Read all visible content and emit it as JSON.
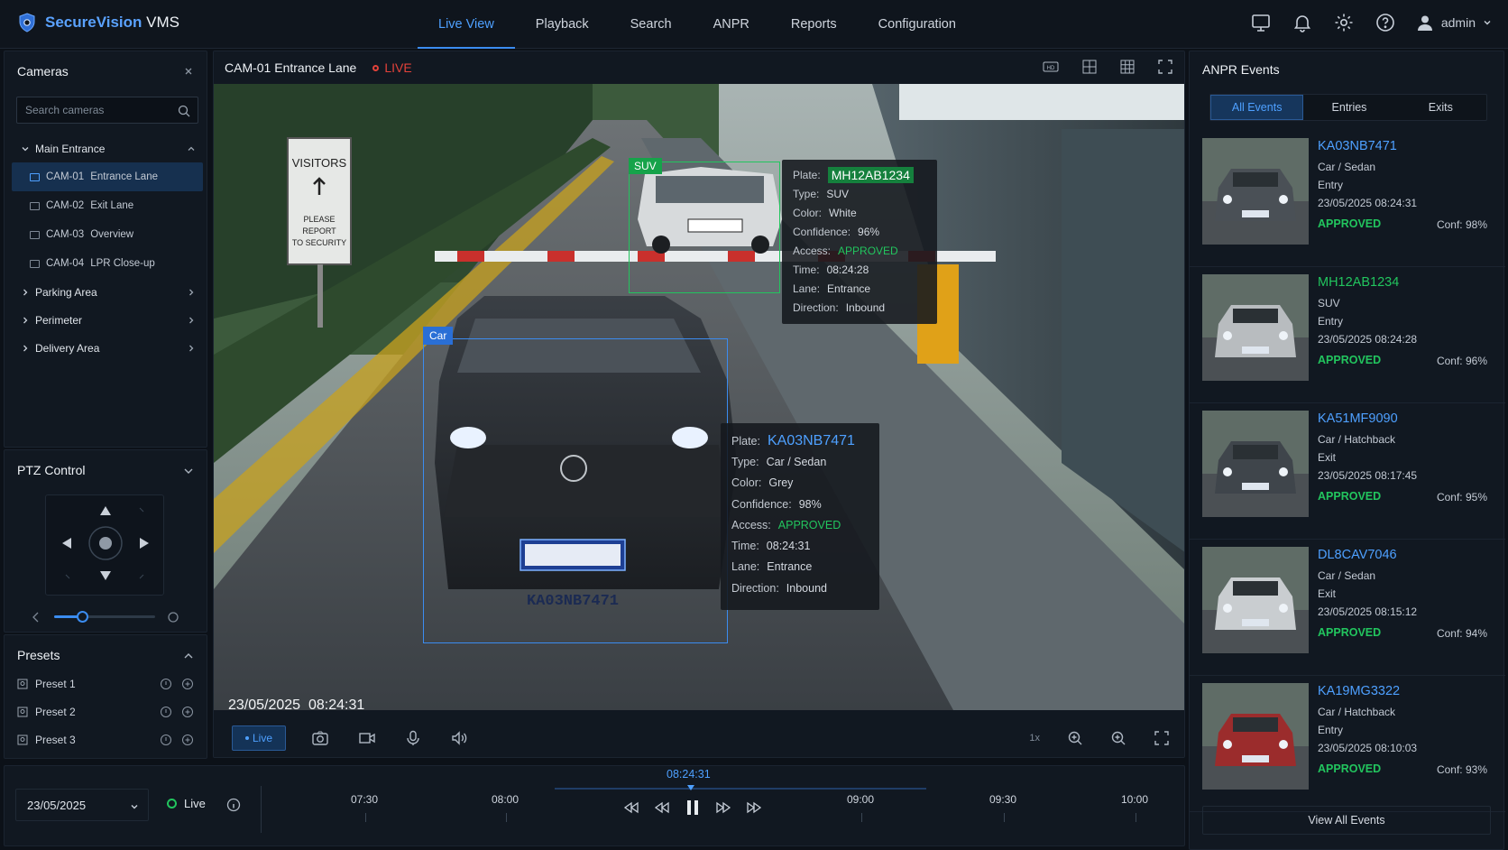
{
  "app": {
    "name_brand": "SecureVision",
    "name_suffix": "VMS"
  },
  "nav": {
    "tabs": [
      "Live View",
      "Playback",
      "Search",
      "ANPR",
      "Reports",
      "Configuration"
    ],
    "active": 0
  },
  "user": {
    "name": "admin"
  },
  "cameras_panel": {
    "title": "Cameras",
    "search_placeholder": "Search cameras",
    "groups": [
      {
        "name": "Main Entrance",
        "expanded": true,
        "cameras": [
          {
            "id": "CAM-01",
            "name": "Entrance Lane",
            "selected": true
          },
          {
            "id": "CAM-02",
            "name": "Exit Lane"
          },
          {
            "id": "CAM-03",
            "name": "Overview"
          },
          {
            "id": "CAM-04",
            "name": "LPR Close-up"
          }
        ]
      },
      {
        "name": "Parking Area"
      },
      {
        "name": "Perimeter"
      },
      {
        "name": "Delivery Area"
      }
    ]
  },
  "ptz": {
    "title": "PTZ Control",
    "zoom_level": 0.28
  },
  "presets": {
    "title": "Presets",
    "items": [
      "Preset 1",
      "Preset 2",
      "Preset 3"
    ]
  },
  "video": {
    "camera_title": "CAM-01 Entrance Lane",
    "live_label": "LIVE",
    "timestamp": "23/05/2025  08:24:31",
    "sign": {
      "line1": "VISITORS",
      "line2": "PLEASE",
      "line3": "REPORT",
      "line4": "TO SECURITY"
    },
    "detections": [
      {
        "tag": "SUV",
        "plate": "MH12AB1234",
        "type": "SUV",
        "color": "White",
        "confidence": "96%",
        "access": "APPROVED",
        "time": "08:24:28",
        "lane": "Entrance",
        "direction": "Inbound"
      },
      {
        "tag": "Car",
        "plate": "KA03NB7471",
        "type": "Car / Sedan",
        "color": "Grey",
        "confidence": "98%",
        "access": "APPROVED",
        "time": "08:24:31",
        "lane": "Entrance",
        "direction": "Inbound"
      }
    ],
    "info_labels": {
      "plate": "Plate:",
      "type": "Type:",
      "color": "Color:",
      "confidence": "Confidence:",
      "access": "Access:",
      "time": "Time:",
      "lane": "Lane:",
      "direction": "Direction:"
    },
    "controls": {
      "live_btn": "Live",
      "speed": "1x"
    }
  },
  "anpr": {
    "title": "ANPR Events",
    "filters": [
      "All Events",
      "Entries",
      "Exits"
    ],
    "active_filter": 0,
    "events": [
      {
        "plate": "KA03NB7471",
        "type": "Car / Sedan",
        "dir": "Entry",
        "datetime": "23/05/2025 08:24:31",
        "status": "APPROVED",
        "conf": "Conf: 98%",
        "color": "blue"
      },
      {
        "plate": "MH12AB1234",
        "type": "SUV",
        "dir": "Entry",
        "datetime": "23/05/2025 08:24:28",
        "status": "APPROVED",
        "conf": "Conf: 96%",
        "color": "green"
      },
      {
        "plate": "KA51MF9090",
        "type": "Car / Hatchback",
        "dir": "Exit",
        "datetime": "23/05/2025 08:17:45",
        "status": "APPROVED",
        "conf": "Conf: 95%",
        "color": "blue"
      },
      {
        "plate": "DL8CAV7046",
        "type": "Car / Sedan",
        "dir": "Exit",
        "datetime": "23/05/2025 08:15:12",
        "status": "APPROVED",
        "conf": "Conf: 94%",
        "color": "blue"
      },
      {
        "plate": "KA19MG3322",
        "type": "Car / Hatchback",
        "dir": "Entry",
        "datetime": "23/05/2025 08:10:03",
        "status": "APPROVED",
        "conf": "Conf: 93%",
        "color": "blue"
      }
    ],
    "view_all": "View All Events"
  },
  "timeline": {
    "date": "23/05/2025",
    "live_label": "Live",
    "cursor_time": "08:24:31",
    "ticks": [
      "07:30",
      "08:00",
      "09:00",
      "09:30",
      "10:00"
    ]
  },
  "colors": {
    "accent": "#3b8cf0",
    "green": "#22c55e",
    "live_red": "#e2423a",
    "blue_plate": "#4ea0ff"
  }
}
